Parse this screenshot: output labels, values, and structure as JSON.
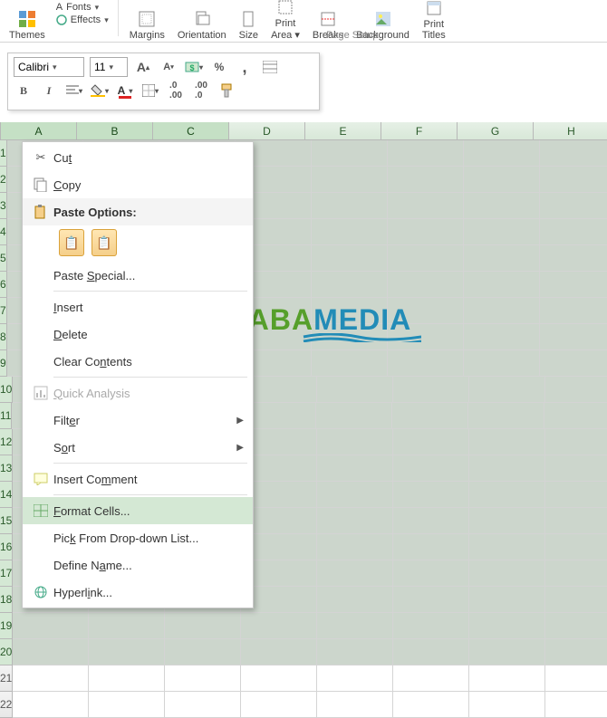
{
  "ribbon": {
    "themes": "Themes",
    "fonts": "Fonts",
    "effects": "Effects",
    "margins": "Margins",
    "orientation": "Orientation",
    "size": "Size",
    "print_area": "Print\nArea",
    "breaks": "Breaks",
    "background": "Background",
    "print_titles": "Print\nTitles",
    "page_setup": "Page Setup"
  },
  "mini_toolbar": {
    "font_name": "Calibri",
    "font_size": "11",
    "bold": "B",
    "italic": "I",
    "percent": "%",
    "comma": ","
  },
  "grid": {
    "columns": [
      "A",
      "B",
      "C",
      "D",
      "E",
      "F",
      "G",
      "H"
    ],
    "selected_cols": [
      "A",
      "B",
      "C"
    ],
    "rows": [
      1,
      2,
      3,
      4,
      5,
      6,
      7,
      8,
      9,
      10,
      11,
      12,
      13,
      14,
      15,
      16,
      17,
      18,
      19,
      20,
      21,
      22
    ],
    "first_unselected_row": 21
  },
  "context_menu": {
    "cut": "Cut",
    "copy": "Copy",
    "paste_options": "Paste Options:",
    "paste_special": "Paste Special...",
    "insert": "Insert",
    "delete": "Delete",
    "clear_contents": "Clear Contents",
    "quick_analysis": "Quick Analysis",
    "filter": "Filter",
    "sort": "Sort",
    "insert_comment": "Insert Comment",
    "format_cells": "Format Cells...",
    "pick_list": "Pick From Drop-down List...",
    "define_name": "Define Name...",
    "hyperlink": "Hyperlink..."
  },
  "watermark": {
    "left": "NESABA",
    "right": "MEDIA"
  },
  "colors": {
    "highlight_border": "#e11",
    "menu_highlight": "#d4e8d4"
  }
}
